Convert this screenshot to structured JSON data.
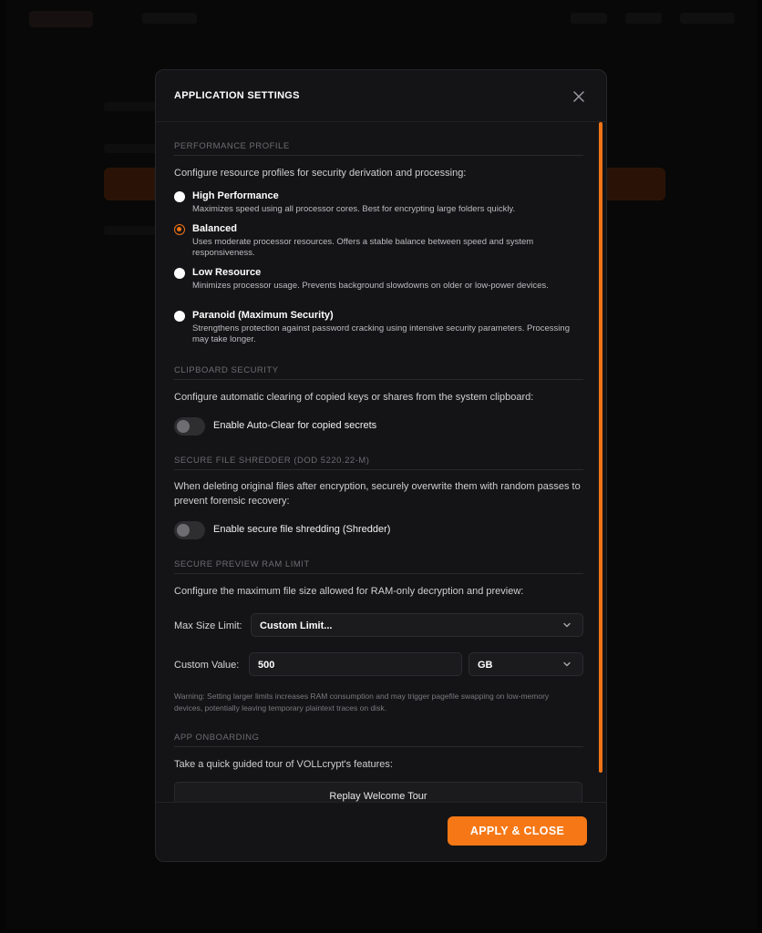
{
  "modal": {
    "title": "APPLICATION SETTINGS",
    "close_icon": "close-icon"
  },
  "performance": {
    "section_title": "PERFORMANCE PROFILE",
    "description": "Configure resource profiles for security derivation and processing:",
    "selected": "Balanced",
    "options": [
      {
        "label": "High Performance",
        "description": "Maximizes speed using all processor cores. Best for encrypting large folders quickly.",
        "checked": false
      },
      {
        "label": "Balanced",
        "description": "Uses moderate processor resources. Offers a stable balance between speed and system responsiveness.",
        "checked": true
      },
      {
        "label": "Low Resource",
        "description": "Minimizes processor usage. Prevents background slowdowns on older or low-power devices.",
        "checked": false
      },
      {
        "label": "Paranoid (Maximum Security)",
        "description": "Strengthens protection against password cracking using intensive security parameters. Processing may take longer.",
        "checked": false
      }
    ]
  },
  "clipboard": {
    "section_title": "CLIPBOARD SECURITY",
    "description": "Configure automatic clearing of copied keys or shares from the system clipboard:",
    "toggle_label": "Enable Auto-Clear for copied secrets",
    "enabled": false
  },
  "shredder": {
    "section_title": "SECURE FILE SHREDDER (DOD 5220.22-M)",
    "description": "When deleting original files after encryption, securely overwrite them with random passes to prevent forensic recovery:",
    "toggle_label": "Enable secure file shredding (Shredder)",
    "enabled": false
  },
  "ram_limit": {
    "section_title": "SECURE PREVIEW RAM LIMIT",
    "description": "Configure the maximum file size allowed for RAM-only decryption and preview:",
    "max_size_label": "Max Size Limit:",
    "max_size_value": "Custom Limit...",
    "custom_value_label": "Custom Value:",
    "custom_value": "500",
    "unit_value": "GB",
    "warning": "Warning: Setting larger limits increases RAM consumption and may trigger pagefile swapping on low-memory devices, potentially leaving temporary plaintext traces on disk."
  },
  "onboarding": {
    "section_title": "APP ONBOARDING",
    "description": "Take a quick guided tour of VOLLcrypt's features:",
    "replay_label": "Replay Welcome Tour"
  },
  "footer": {
    "apply_label": "APPLY & CLOSE"
  },
  "colors": {
    "accent": "#f57716",
    "modal_bg": "#141416",
    "backdrop": "#050505"
  }
}
